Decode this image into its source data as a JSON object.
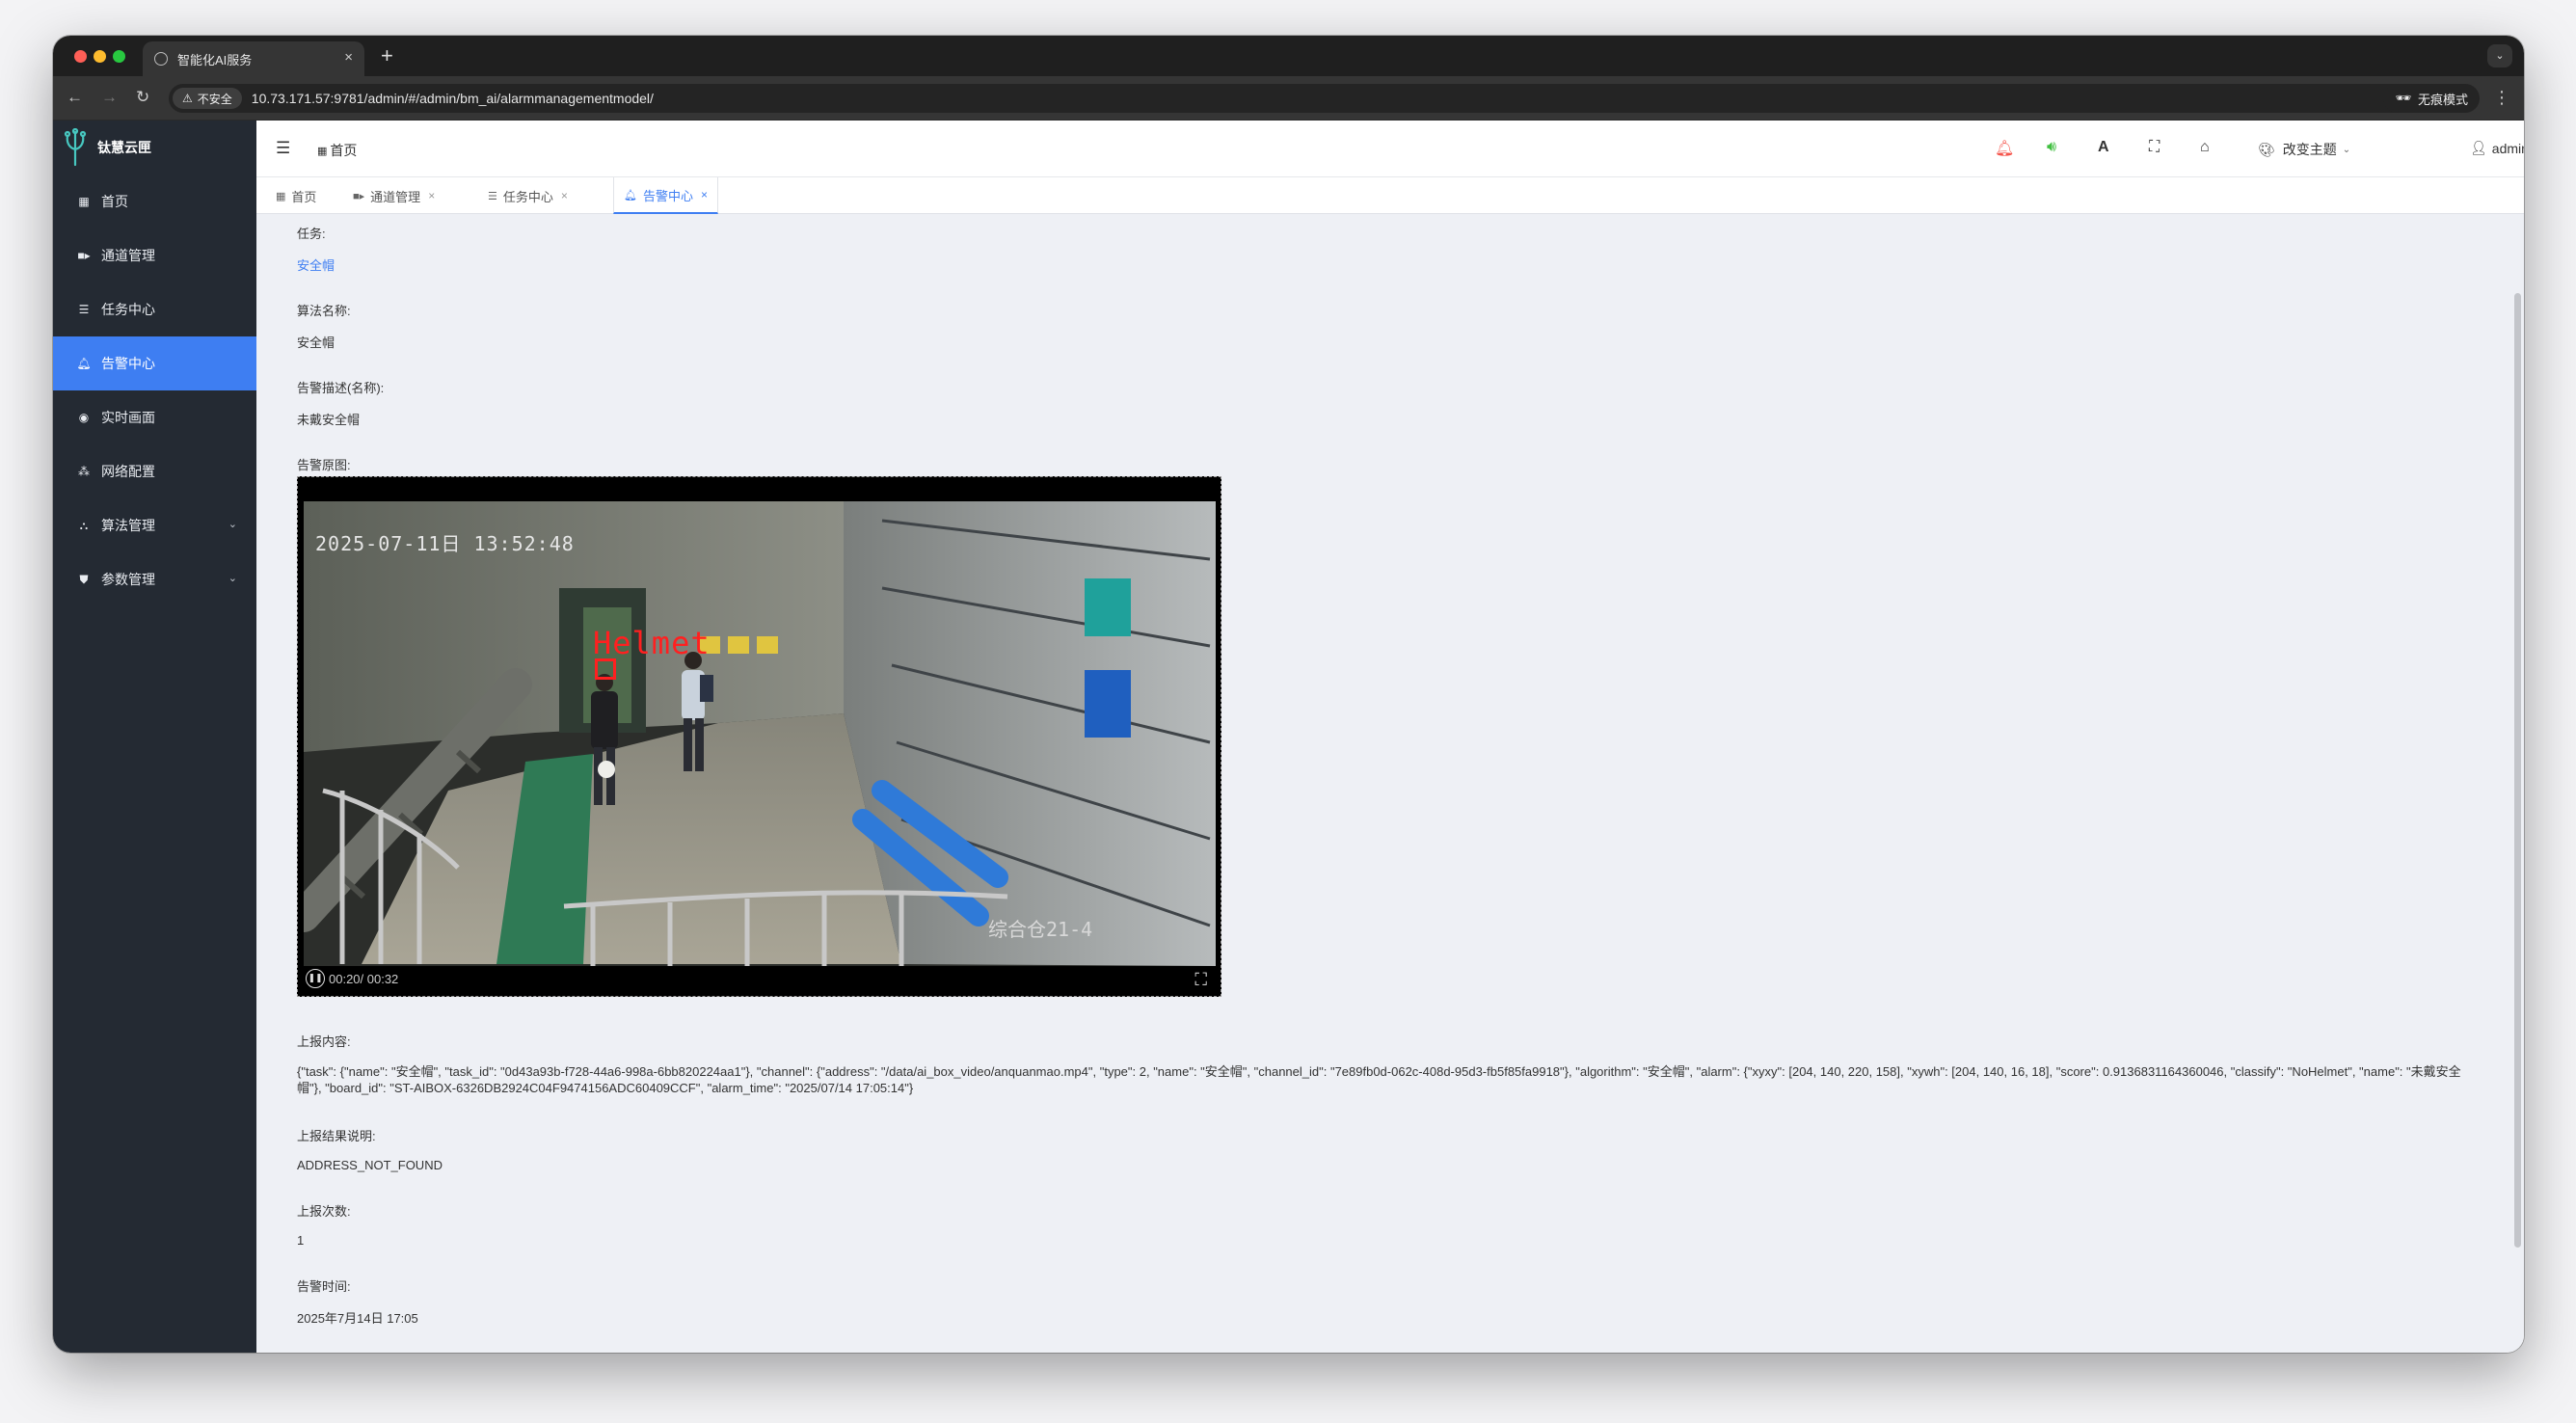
{
  "browser": {
    "tab_title": "智能化AI服务",
    "tab_close": "×",
    "new_tab": "+",
    "insecure_label": "不安全",
    "url": "10.73.171.57:9781/admin/#/admin/bm_ai/alarmmanagementmodel/",
    "incognito_label": "无痕模式"
  },
  "sidebar": {
    "logo_text": "钛慧云匣",
    "items": [
      {
        "label": "首页",
        "icon": "grid-icon"
      },
      {
        "label": "通道管理",
        "icon": "video-camera-icon"
      },
      {
        "label": "任务中心",
        "icon": "server-icon"
      },
      {
        "label": "告警中心",
        "icon": "bell-icon",
        "active": true
      },
      {
        "label": "实时画面",
        "icon": "eye-icon"
      },
      {
        "label": "网络配置",
        "icon": "network-icon"
      },
      {
        "label": "算法管理",
        "icon": "cubes-icon",
        "expandable": true
      },
      {
        "label": "参数管理",
        "icon": "shield-icon",
        "expandable": true
      }
    ]
  },
  "header": {
    "breadcrumb": "首页",
    "theme_label": "改变主题",
    "user_label": "admin"
  },
  "tabs": [
    {
      "label": "首页",
      "closable": false
    },
    {
      "label": "通道管理",
      "closable": true
    },
    {
      "label": "任务中心",
      "closable": true
    },
    {
      "label": "告警中心",
      "closable": true,
      "active": true
    }
  ],
  "tab_close_glyph": "×",
  "detail": {
    "task_label": "任务:",
    "task_value": "安全帽",
    "algo_label": "算法名称:",
    "algo_value": "安全帽",
    "desc_label": "告警描述(名称):",
    "desc_value": "未戴安全帽",
    "image_label": "告警原图:",
    "report_label": "上报内容:",
    "report_value": "{\"task\": {\"name\": \"安全帽\", \"task_id\": \"0d43a93b-f728-44a6-998a-6bb820224aa1\"}, \"channel\": {\"address\": \"/data/ai_box_video/anquanmao.mp4\", \"type\": 2, \"name\": \"安全帽\", \"channel_id\": \"7e89fb0d-062c-408d-95d3-fb5f85fa9918\"}, \"algorithm\": \"安全帽\", \"alarm\": {\"xyxy\": [204, 140, 220, 158], \"xywh\": [204, 140, 16, 18], \"score\": 0.9136831164360046, \"classify\": \"NoHelmet\", \"name\": \"未戴安全帽\"}, \"board_id\": \"ST-AIBOX-6326DB2924C04F9474156ADC60409CCF\", \"alarm_time\": \"2025/07/14 17:05:14\"}",
    "result_label": "上报结果说明:",
    "result_value": "ADDRESS_NOT_FOUND",
    "count_label": "上报次数:",
    "count_value": "1",
    "time_label": "告警时间:",
    "time_value": "2025年7月14日 17:05"
  },
  "video": {
    "osd_date": "2025-07-11日 13:52:48",
    "detection_label": "Helmet",
    "location_text": "综合仓21-4",
    "current_time": "00:20",
    "duration": "00:32",
    "time_display": "00:20/ 00:32"
  },
  "colors": {
    "accent": "#3e7ef2",
    "sidebar_bg": "#242a33",
    "bell_red": "#f5544b",
    "speaker_green": "#3fbf3f"
  }
}
